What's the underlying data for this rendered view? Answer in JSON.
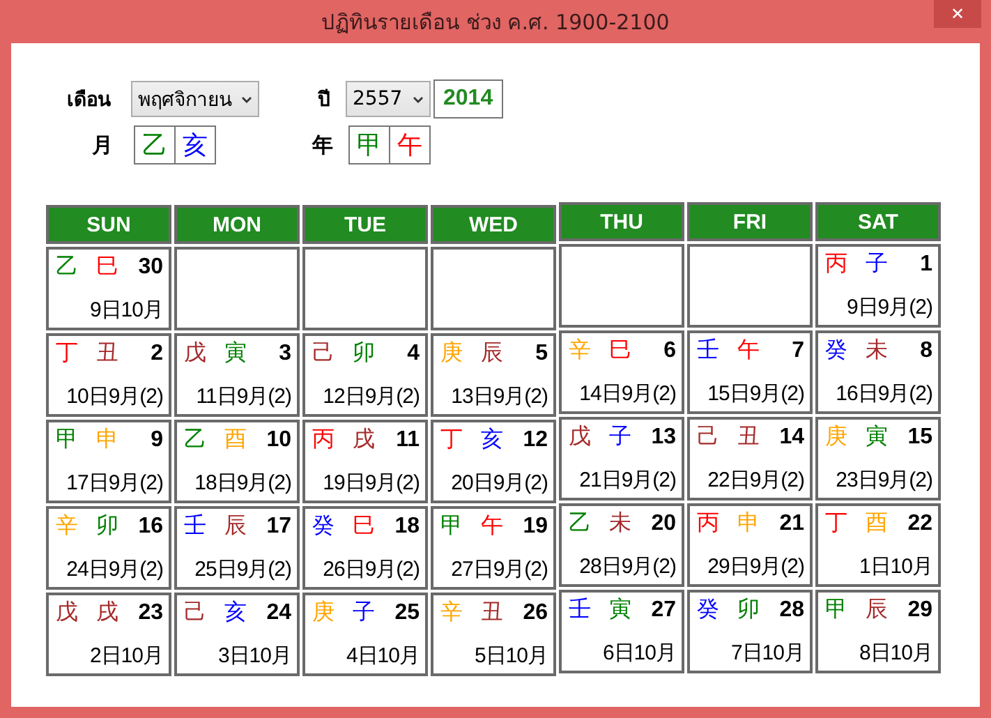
{
  "window": {
    "title": "ปฏิทินรายเดือน ช่วง ค.ศ. 1900-2100",
    "close": "✕"
  },
  "controls": {
    "month_label": "เดือน",
    "month": "พฤศจิกายน",
    "year_label": "ปี",
    "year": "2557",
    "year_ad": "2014",
    "month_gz_label": "月",
    "month_gz": [
      {
        "text": "乙",
        "color": "#008000"
      },
      {
        "text": "亥",
        "color": "#0000ff"
      }
    ],
    "year_gz_label": "年",
    "year_gz": [
      {
        "text": "甲",
        "color": "#008000"
      },
      {
        "text": "午",
        "color": "#ff0000"
      }
    ]
  },
  "weekdays": [
    "SUN",
    "MON",
    "TUE",
    "WED",
    "THU",
    "FRI",
    "SAT"
  ],
  "weeks": [
    [
      {
        "kind": "day",
        "stem": {
          "text": "乙",
          "color": "#008000"
        },
        "branch": {
          "text": "巳",
          "color": "#ff0000"
        },
        "day": "30",
        "lunar": "9日10月"
      },
      {
        "kind": "empty"
      },
      {
        "kind": "empty"
      },
      {
        "kind": "empty"
      },
      {
        "kind": "empty"
      },
      {
        "kind": "empty"
      },
      {
        "kind": "day",
        "stem": {
          "text": "丙",
          "color": "#ff0000"
        },
        "branch": {
          "text": "子",
          "color": "#0000ff"
        },
        "day": "1",
        "lunar": "9日9月(2)"
      }
    ],
    [
      {
        "kind": "day",
        "stem": {
          "text": "丁",
          "color": "#ff0000"
        },
        "branch": {
          "text": "丑",
          "color": "#a52a2a"
        },
        "day": "2",
        "lunar": "10日9月(2)"
      },
      {
        "kind": "day",
        "stem": {
          "text": "戊",
          "color": "#a52a2a"
        },
        "branch": {
          "text": "寅",
          "color": "#008000"
        },
        "day": "3",
        "lunar": "11日9月(2)"
      },
      {
        "kind": "day",
        "stem": {
          "text": "己",
          "color": "#a52a2a"
        },
        "branch": {
          "text": "卯",
          "color": "#008000"
        },
        "day": "4",
        "lunar": "12日9月(2)"
      },
      {
        "kind": "day",
        "stem": {
          "text": "庚",
          "color": "#ffa500"
        },
        "branch": {
          "text": "辰",
          "color": "#a52a2a"
        },
        "day": "5",
        "lunar": "13日9月(2)"
      },
      {
        "kind": "day",
        "stem": {
          "text": "辛",
          "color": "#ffa500"
        },
        "branch": {
          "text": "巳",
          "color": "#ff0000"
        },
        "day": "6",
        "lunar": "14日9月(2)"
      },
      {
        "kind": "day",
        "stem": {
          "text": "壬",
          "color": "#0000ff"
        },
        "branch": {
          "text": "午",
          "color": "#ff0000"
        },
        "day": "7",
        "lunar": "15日9月(2)"
      },
      {
        "kind": "day",
        "stem": {
          "text": "癸",
          "color": "#0000ff"
        },
        "branch": {
          "text": "未",
          "color": "#a52a2a"
        },
        "day": "8",
        "lunar": "16日9月(2)"
      }
    ],
    [
      {
        "kind": "day",
        "stem": {
          "text": "甲",
          "color": "#008000"
        },
        "branch": {
          "text": "申",
          "color": "#ffa500"
        },
        "day": "9",
        "lunar": "17日9月(2)"
      },
      {
        "kind": "day",
        "stem": {
          "text": "乙",
          "color": "#008000"
        },
        "branch": {
          "text": "酉",
          "color": "#ffa500"
        },
        "day": "10",
        "lunar": "18日9月(2)"
      },
      {
        "kind": "day",
        "stem": {
          "text": "丙",
          "color": "#ff0000"
        },
        "branch": {
          "text": "戌",
          "color": "#a52a2a"
        },
        "day": "11",
        "lunar": "19日9月(2)"
      },
      {
        "kind": "day",
        "stem": {
          "text": "丁",
          "color": "#ff0000"
        },
        "branch": {
          "text": "亥",
          "color": "#0000ff"
        },
        "day": "12",
        "lunar": "20日9月(2)"
      },
      {
        "kind": "day",
        "stem": {
          "text": "戊",
          "color": "#a52a2a"
        },
        "branch": {
          "text": "子",
          "color": "#0000ff"
        },
        "day": "13",
        "lunar": "21日9月(2)"
      },
      {
        "kind": "day",
        "stem": {
          "text": "己",
          "color": "#a52a2a"
        },
        "branch": {
          "text": "丑",
          "color": "#a52a2a"
        },
        "day": "14",
        "lunar": "22日9月(2)"
      },
      {
        "kind": "day",
        "stem": {
          "text": "庚",
          "color": "#ffa500"
        },
        "branch": {
          "text": "寅",
          "color": "#008000"
        },
        "day": "15",
        "lunar": "23日9月(2)"
      }
    ],
    [
      {
        "kind": "day",
        "stem": {
          "text": "辛",
          "color": "#ffa500"
        },
        "branch": {
          "text": "卯",
          "color": "#008000"
        },
        "day": "16",
        "lunar": "24日9月(2)"
      },
      {
        "kind": "day",
        "stem": {
          "text": "壬",
          "color": "#0000ff"
        },
        "branch": {
          "text": "辰",
          "color": "#a52a2a"
        },
        "day": "17",
        "lunar": "25日9月(2)"
      },
      {
        "kind": "day",
        "stem": {
          "text": "癸",
          "color": "#0000ff"
        },
        "branch": {
          "text": "巳",
          "color": "#ff0000"
        },
        "day": "18",
        "lunar": "26日9月(2)"
      },
      {
        "kind": "day",
        "stem": {
          "text": "甲",
          "color": "#008000"
        },
        "branch": {
          "text": "午",
          "color": "#ff0000"
        },
        "day": "19",
        "lunar": "27日9月(2)"
      },
      {
        "kind": "day",
        "stem": {
          "text": "乙",
          "color": "#008000"
        },
        "branch": {
          "text": "未",
          "color": "#a52a2a"
        },
        "day": "20",
        "lunar": "28日9月(2)"
      },
      {
        "kind": "day",
        "stem": {
          "text": "丙",
          "color": "#ff0000"
        },
        "branch": {
          "text": "申",
          "color": "#ffa500"
        },
        "day": "21",
        "lunar": "29日9月(2)"
      },
      {
        "kind": "day",
        "stem": {
          "text": "丁",
          "color": "#ff0000"
        },
        "branch": {
          "text": "酉",
          "color": "#ffa500"
        },
        "day": "22",
        "lunar": "1日10月"
      }
    ],
    [
      {
        "kind": "day",
        "stem": {
          "text": "戊",
          "color": "#a52a2a"
        },
        "branch": {
          "text": "戌",
          "color": "#a52a2a"
        },
        "day": "23",
        "lunar": "2日10月"
      },
      {
        "kind": "day",
        "stem": {
          "text": "己",
          "color": "#a52a2a"
        },
        "branch": {
          "text": "亥",
          "color": "#0000ff"
        },
        "day": "24",
        "lunar": "3日10月"
      },
      {
        "kind": "day",
        "stem": {
          "text": "庚",
          "color": "#ffa500"
        },
        "branch": {
          "text": "子",
          "color": "#0000ff"
        },
        "day": "25",
        "lunar": "4日10月"
      },
      {
        "kind": "day",
        "stem": {
          "text": "辛",
          "color": "#ffa500"
        },
        "branch": {
          "text": "丑",
          "color": "#a52a2a"
        },
        "day": "26",
        "lunar": "5日10月"
      },
      {
        "kind": "day",
        "stem": {
          "text": "壬",
          "color": "#0000ff"
        },
        "branch": {
          "text": "寅",
          "color": "#008000"
        },
        "day": "27",
        "lunar": "6日10月"
      },
      {
        "kind": "day",
        "stem": {
          "text": "癸",
          "color": "#0000ff"
        },
        "branch": {
          "text": "卯",
          "color": "#008000"
        },
        "day": "28",
        "lunar": "7日10月"
      },
      {
        "kind": "day",
        "stem": {
          "text": "甲",
          "color": "#008000"
        },
        "branch": {
          "text": "辰",
          "color": "#a52a2a"
        },
        "day": "29",
        "lunar": "8日10月"
      }
    ]
  ]
}
